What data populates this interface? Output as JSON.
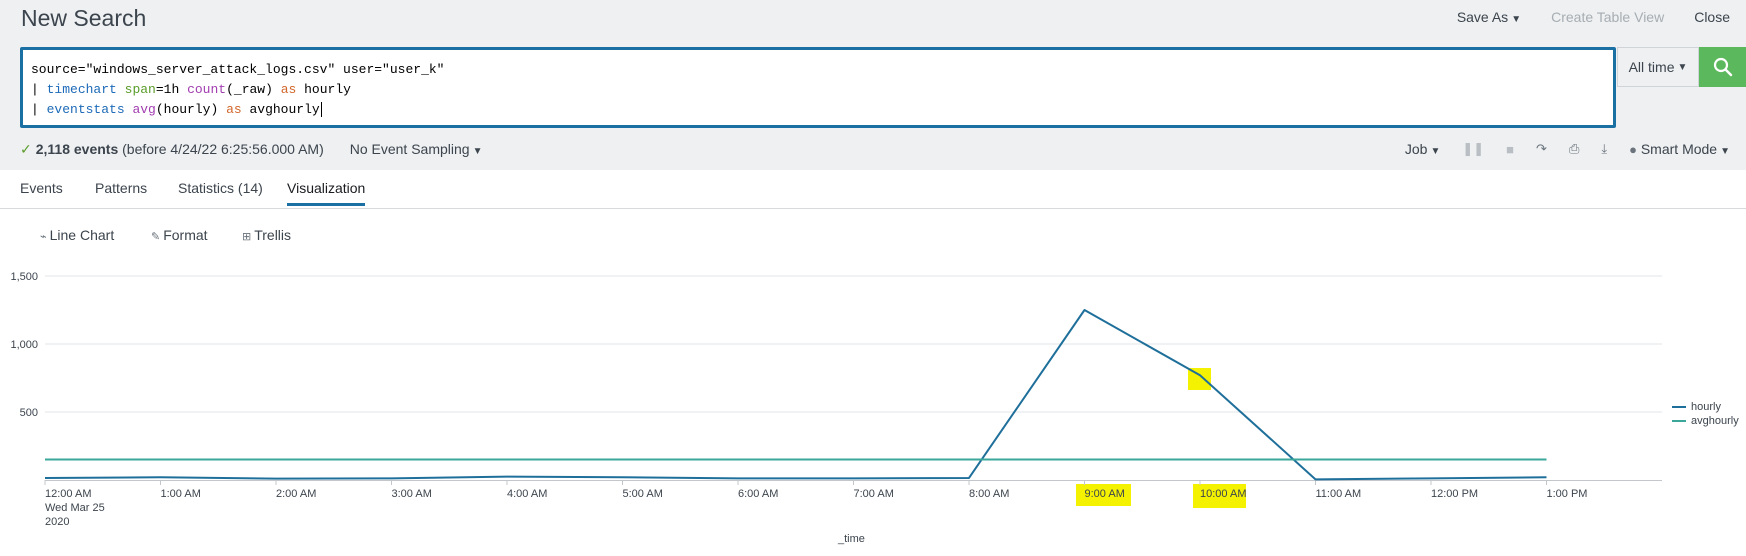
{
  "header": {
    "title": "New Search",
    "save_as": "Save As",
    "create_table_view": "Create Table View",
    "close": "Close"
  },
  "search": {
    "line1": "source=\"windows_server_attack_logs.csv\" user=\"user_k\"",
    "line2": {
      "pipe": "| ",
      "cmd": "timechart",
      "sp1": " ",
      "arg": "span",
      "val": "=1h ",
      "fn": "count",
      "fnarg": "(_raw) ",
      "as": "as",
      "name": " hourly"
    },
    "line3": {
      "pipe": "| ",
      "cmd": "eventstats",
      "sp1": " ",
      "fn": "avg",
      "fnarg": "(hourly) ",
      "as": "as",
      "name": " avghourly"
    },
    "time_range": "All time"
  },
  "status": {
    "events_count": "2,118 events",
    "events_detail": "(before 4/24/22 6:25:56.000 AM)",
    "sampling": "No Event Sampling"
  },
  "jobbar": {
    "job": "Job",
    "mode": "Smart Mode"
  },
  "tabs": [
    "Events",
    "Patterns",
    "Statistics (14)",
    "Visualization"
  ],
  "active_tab": "Visualization",
  "viz_tools": {
    "chart_type": "Line Chart",
    "format": "Format",
    "trellis": "Trellis"
  },
  "colors": {
    "hourly": "#1f6f9b",
    "avghourly": "#3aa79a",
    "highlight": "#f4f201",
    "accent": "#1a6fa3",
    "search_button": "#5cb85c"
  },
  "chart_data": {
    "type": "line",
    "x": [
      "12:00 AM",
      "1:00 AM",
      "2:00 AM",
      "3:00 AM",
      "4:00 AM",
      "5:00 AM",
      "6:00 AM",
      "7:00 AM",
      "8:00 AM",
      "9:00 AM",
      "10:00 AM",
      "11:00 AM",
      "12:00 PM",
      "1:00 PM"
    ],
    "x_first_sublabel": [
      "Wed Mar 25",
      "2020"
    ],
    "xlabel": "_time",
    "yticks": [
      500,
      1000,
      1500
    ],
    "ytick_labels": [
      "500",
      "1,000",
      "1,500"
    ],
    "ylim": [
      0,
      1500
    ],
    "series": [
      {
        "name": "hourly",
        "values": [
          15,
          20,
          10,
          12,
          25,
          20,
          12,
          12,
          15,
          1250,
          770,
          5,
          12,
          20
        ]
      },
      {
        "name": "avghourly",
        "values": [
          151,
          151,
          151,
          151,
          151,
          151,
          151,
          151,
          151,
          151,
          151,
          151,
          151,
          151
        ]
      }
    ],
    "legend_position": "right",
    "highlighted_ticks": [
      "9:00 AM",
      "10:00 AM"
    ],
    "grid": true
  }
}
